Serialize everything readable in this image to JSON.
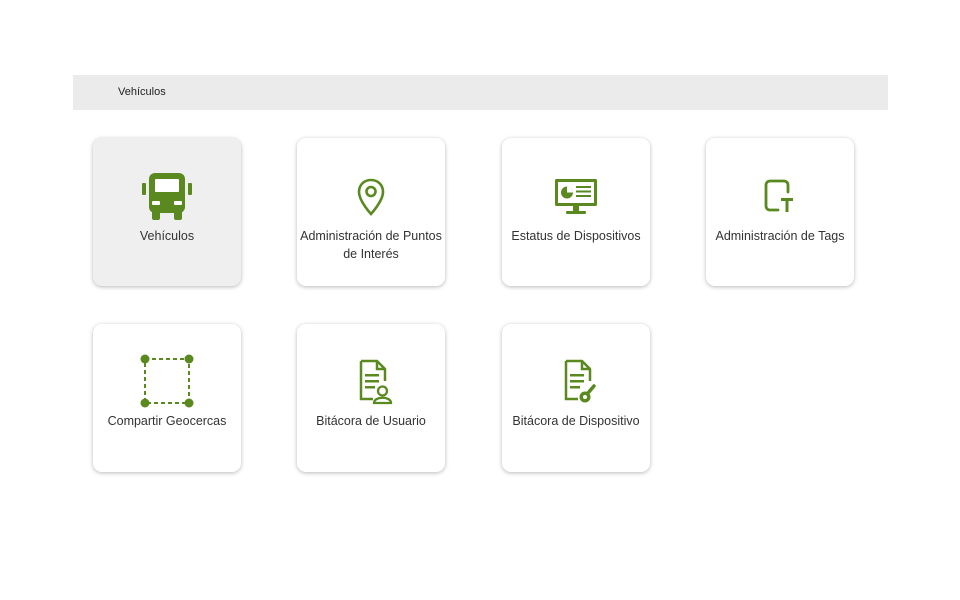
{
  "breadcrumb": {
    "current": "Vehículos"
  },
  "accent_color": "#5a8a1f",
  "tiles": [
    {
      "label": "Vehículos",
      "icon": "bus-icon",
      "active": true
    },
    {
      "label": "Administración de Puntos de Interés",
      "icon": "location-pin-icon"
    },
    {
      "label": "Estatus de Dispositivos",
      "icon": "monitor-chart-icon"
    },
    {
      "label": "Administración de Tags",
      "icon": "tag-icon"
    },
    {
      "label": "Compartir Geocercas",
      "icon": "geofence-icon"
    },
    {
      "label": "Bitácora de Usuario",
      "icon": "user-log-icon"
    },
    {
      "label": "Bitácora de Dispositivo",
      "icon": "device-log-icon"
    }
  ]
}
